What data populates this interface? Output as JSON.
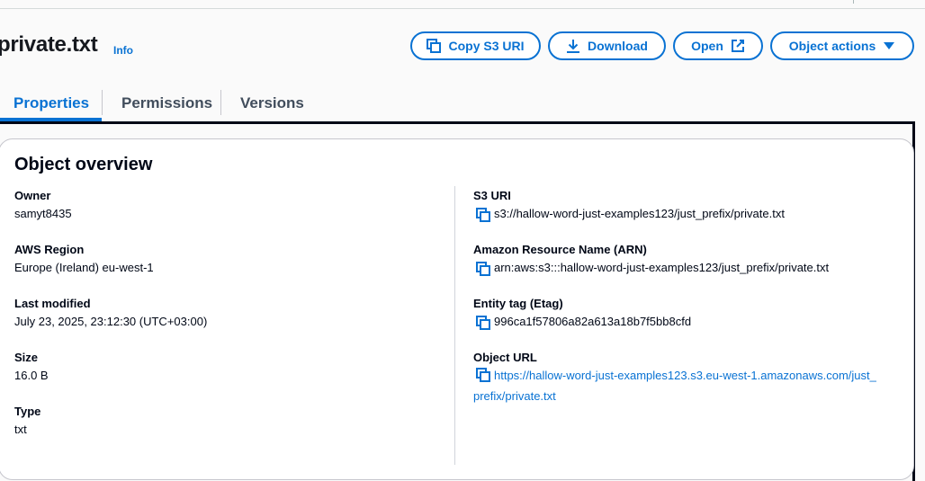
{
  "header": {
    "title": "private.txt",
    "info": "Info"
  },
  "actions": {
    "copy_s3_uri": "Copy S3 URI",
    "download": "Download",
    "open": "Open",
    "object_actions": "Object actions"
  },
  "tabs": [
    {
      "label": "Properties",
      "active": true
    },
    {
      "label": "Permissions",
      "active": false
    },
    {
      "label": "Versions",
      "active": false
    }
  ],
  "overview": {
    "title": "Object overview",
    "left": [
      {
        "label": "Owner",
        "value": "samyt8435"
      },
      {
        "label": "AWS Region",
        "value": "Europe (Ireland) eu-west-1"
      },
      {
        "label": "Last modified",
        "value": "July 23, 2025, 23:12:30 (UTC+03:00)"
      },
      {
        "label": "Size",
        "value": "16.0 B"
      },
      {
        "label": "Type",
        "value": "txt"
      }
    ],
    "right": [
      {
        "label": "S3 URI",
        "value": "s3://hallow-word-just-examples123/just_prefix/private.txt"
      },
      {
        "label": "Amazon Resource Name (ARN)",
        "value": "arn:aws:s3:::hallow-word-just-examples123/just_prefix/private.txt"
      },
      {
        "label": "Entity tag (Etag)",
        "value": "996ca1f57806a82a613a18b7f5bb8cfd"
      },
      {
        "label": "Object URL",
        "value": "https://hallow-word-just-examples123.s3.eu-west-1.amazonaws.com/just_prefix/private.txt"
      }
    ]
  },
  "colors": {
    "accent": "#0972d3",
    "text": "#000716",
    "tab_inactive": "#414d5c"
  },
  "icons": [
    "copy-icon",
    "download-icon",
    "external-link-icon",
    "caret-down-icon"
  ]
}
